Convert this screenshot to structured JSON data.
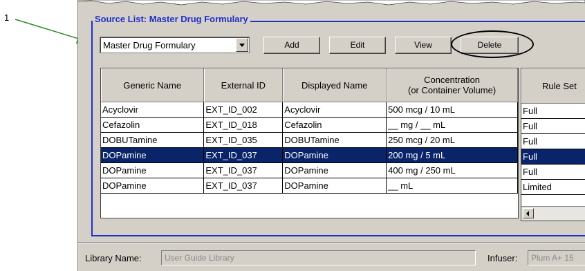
{
  "callout": {
    "number": "1"
  },
  "group": {
    "title": "Source List: Master Drug Formulary"
  },
  "source_select": {
    "value": "Master Drug Formulary"
  },
  "buttons": {
    "add": "Add",
    "edit": "Edit",
    "view": "View",
    "delete": "Delete"
  },
  "grid": {
    "headers": [
      "Generic Name",
      "External ID",
      "Displayed Name",
      "Concentration",
      "(or Container Volume)"
    ],
    "rows": [
      [
        "Acyclovir",
        "EXT_ID_002",
        "Acyclovir",
        "500 mcg / 10 mL"
      ],
      [
        "Cefazolin",
        "EXT_ID_018",
        "Cefazolin",
        "__ mg / __ mL"
      ],
      [
        "DOBUTamine",
        "EXT_ID_035",
        "DOBUTamine",
        "250 mcg / 20 mL"
      ],
      [
        "DOPamine",
        "EXT_ID_037",
        "DOPamine",
        "200 mg / 5 mL"
      ],
      [
        "DOPamine",
        "EXT_ID_037",
        "DOPamine",
        "400 mg / 250 mL"
      ],
      [
        "DOPamine",
        "EXT_ID_037",
        "DOPamine",
        "__ mL"
      ]
    ],
    "selected_row": 3
  },
  "rule_sets": {
    "header": "Rule Set",
    "values": [
      "Full",
      "Full",
      "Full",
      "Full",
      "Full",
      "Limited"
    ]
  },
  "footer": {
    "library_label": "Library Name:",
    "library_value": "User Guide Library",
    "infuser_label": "Infuser:",
    "infuser_value": "Plum A+ 15"
  },
  "colors": {
    "accent": "#1f2fc8",
    "selection": "#0a246a",
    "callout_arrow": "#2a8a2a"
  },
  "icons": [
    "dropdown-arrow-icon",
    "scroll-left-arrow-icon"
  ]
}
